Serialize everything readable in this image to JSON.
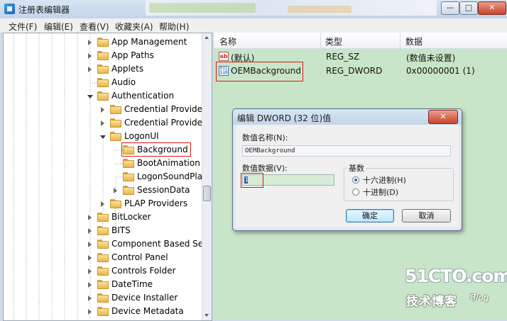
{
  "window": {
    "title": "注册表编辑器",
    "buttons": {
      "minimize": "—",
      "maximize": "□",
      "close": "✕"
    }
  },
  "menu": [
    "文件(F)",
    "编辑(E)",
    "查看(V)",
    "收藏夹(A)",
    "帮助(H)"
  ],
  "tree": {
    "items": [
      {
        "label": "App Management",
        "depth": 0,
        "state": "closed"
      },
      {
        "label": "App Paths",
        "depth": 0,
        "state": "closed"
      },
      {
        "label": "Applets",
        "depth": 0,
        "state": "closed"
      },
      {
        "label": "Audio",
        "depth": 0,
        "state": "none"
      },
      {
        "label": "Authentication",
        "depth": 0,
        "state": "open"
      },
      {
        "label": "Credential Provider",
        "depth": 1,
        "state": "closed"
      },
      {
        "label": "Credential Provider",
        "depth": 1,
        "state": "closed"
      },
      {
        "label": "LogonUI",
        "depth": 1,
        "state": "open"
      },
      {
        "label": "Background",
        "depth": 2,
        "state": "none",
        "selected": true
      },
      {
        "label": "BootAnimation",
        "depth": 2,
        "state": "none"
      },
      {
        "label": "LogonSoundPlay",
        "depth": 2,
        "state": "none"
      },
      {
        "label": "SessionData",
        "depth": 2,
        "state": "closed"
      },
      {
        "label": "PLAP Providers",
        "depth": 1,
        "state": "closed"
      },
      {
        "label": "BitLocker",
        "depth": 0,
        "state": "closed"
      },
      {
        "label": "BITS",
        "depth": 0,
        "state": "closed"
      },
      {
        "label": "Component Based Ser",
        "depth": 0,
        "state": "closed"
      },
      {
        "label": "Control Panel",
        "depth": 0,
        "state": "closed"
      },
      {
        "label": "Controls Folder",
        "depth": 0,
        "state": "closed"
      },
      {
        "label": "DateTime",
        "depth": 0,
        "state": "closed"
      },
      {
        "label": "Device Installer",
        "depth": 0,
        "state": "closed"
      },
      {
        "label": "Device Metadata",
        "depth": 0,
        "state": "closed"
      }
    ]
  },
  "list": {
    "headers": {
      "name": "名称",
      "type": "类型",
      "data": "数据"
    },
    "rows": [
      {
        "icon": "string-value-icon",
        "icon_text": "ab",
        "name": "(默认)",
        "type": "REG_SZ",
        "data": "(数值未设置)"
      },
      {
        "icon": "binary-value-icon",
        "icon_text": "011 110",
        "name": "OEMBackground",
        "type": "REG_DWORD",
        "data": "0x00000001 (1)",
        "highlighted": true
      }
    ]
  },
  "dialog": {
    "title": "编辑 DWORD (32 位)值",
    "close": "✕",
    "name_label": "数值名称(N):",
    "name_value": "OEMBackground",
    "data_label": "数值数据(V):",
    "data_value": "1",
    "base_label": "基数",
    "base_options": [
      {
        "label": "十六进制(H)",
        "checked": true
      },
      {
        "label": "十进制(D)",
        "checked": false
      }
    ],
    "ok": "确定",
    "cancel": "取消"
  },
  "watermark": {
    "logo": "51CTO.com",
    "cn": "技术博客",
    "blog": "Blog"
  }
}
